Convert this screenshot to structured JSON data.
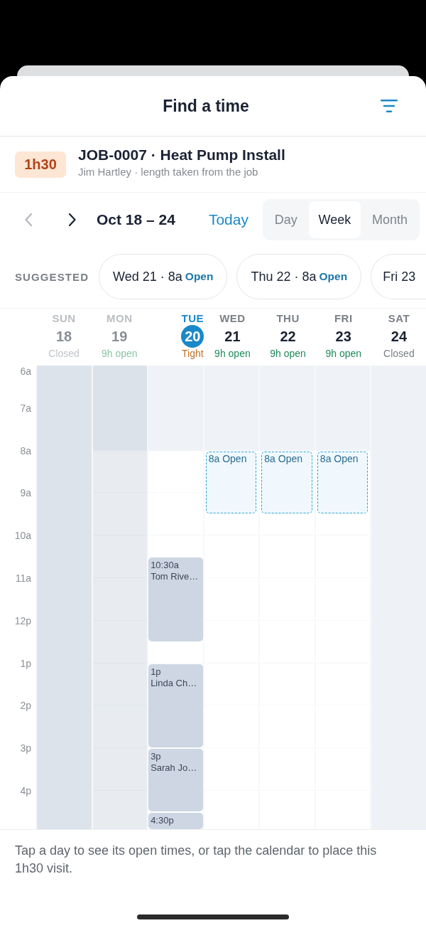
{
  "header": {
    "title": "Find a time"
  },
  "job": {
    "duration": "1h30",
    "title": "JOB-0007 · Heat Pump Install",
    "subtitle": "Jim Hartley · length taken from the job"
  },
  "toolbar": {
    "previous": {
      "disabled": true
    },
    "next": {
      "disabled": false
    },
    "range": "Oct 18 – 24",
    "today": "Today",
    "views": [
      {
        "label": "Day",
        "selected": false
      },
      {
        "label": "Week",
        "selected": true
      },
      {
        "label": "Month",
        "selected": false
      }
    ]
  },
  "suggested": {
    "label": "SUGGESTED",
    "chips": [
      {
        "label": "Wed 21 · 8a",
        "status": "Open"
      },
      {
        "label": "Thu 22 · 8a",
        "status": "Open"
      },
      {
        "label": "Fri 23"
      }
    ]
  },
  "calendar": {
    "hours": [
      "6a",
      "7a",
      "8a",
      "9a",
      "10a",
      "11a",
      "12p",
      "1p",
      "2p",
      "3p",
      "4p"
    ],
    "days": [
      {
        "weekday": "SUN",
        "date": "18",
        "status": "Closed",
        "kind": "closed",
        "past": true,
        "today": false
      },
      {
        "weekday": "MON",
        "date": "19",
        "status": "9h open",
        "kind": "open",
        "past": true,
        "today": false,
        "slots": [
          {
            "kind": "off"
          },
          {
            "kind": "off"
          },
          {
            "kind": "off"
          },
          {
            "kind": "off"
          }
        ]
      },
      {
        "weekday": "TUE",
        "date": "20",
        "status": "Tight",
        "kind": "tight",
        "past": false,
        "today": true,
        "slots": [
          {
            "kind": "off"
          },
          {
            "kind": "off"
          },
          {
            "kind": "off"
          },
          {
            "kind": "off"
          },
          {
            "kind": "free"
          },
          {
            "kind": "free"
          },
          {
            "kind": "free"
          },
          {
            "kind": "free"
          },
          {
            "kind": "free"
          },
          {
            "kind": "booked",
            "time": "10:30a",
            "name": "Tom Rive…"
          },
          {
            "kind": "booked"
          },
          {
            "kind": "booked"
          },
          {
            "kind": "booked"
          },
          {
            "kind": "free"
          },
          {
            "kind": "booked",
            "time": "1p",
            "name": "Linda Ch…"
          },
          {
            "kind": "booked"
          },
          {
            "kind": "booked"
          },
          {
            "kind": "booked"
          },
          {
            "kind": "booked",
            "time": "3p",
            "name": "Sarah Jo…"
          },
          {
            "kind": "booked"
          },
          {
            "kind": "booked"
          },
          {
            "kind": "booked",
            "time": "4:30p"
          }
        ]
      },
      {
        "weekday": "WED",
        "date": "21",
        "status": "9h open",
        "kind": "open",
        "past": false,
        "today": false,
        "slots": [
          {
            "kind": "off"
          },
          {
            "kind": "off"
          },
          {
            "kind": "off"
          },
          {
            "kind": "off"
          },
          {
            "kind": "open",
            "label": "8a Open"
          },
          {
            "kind": "open"
          },
          {
            "kind": "open"
          }
        ]
      },
      {
        "weekday": "THU",
        "date": "22",
        "status": "9h open",
        "kind": "open",
        "past": false,
        "today": false,
        "slots": [
          {
            "kind": "off"
          },
          {
            "kind": "off"
          },
          {
            "kind": "off"
          },
          {
            "kind": "off"
          },
          {
            "kind": "open",
            "label": "8a Open"
          },
          {
            "kind": "open"
          },
          {
            "kind": "open"
          }
        ]
      },
      {
        "weekday": "FRI",
        "date": "23",
        "status": "9h open",
        "kind": "open",
        "past": false,
        "today": false,
        "slots": [
          {
            "kind": "off"
          },
          {
            "kind": "off"
          },
          {
            "kind": "off"
          },
          {
            "kind": "off"
          },
          {
            "kind": "open",
            "label": "8a Open"
          },
          {
            "kind": "open"
          },
          {
            "kind": "open"
          }
        ]
      },
      {
        "weekday": "SAT",
        "date": "24",
        "status": "Closed",
        "kind": "closed",
        "past": false,
        "today": false
      }
    ]
  },
  "footer": {
    "hint": "Tap a day to see its open times, or tap the calendar to place this 1h30 visit."
  }
}
